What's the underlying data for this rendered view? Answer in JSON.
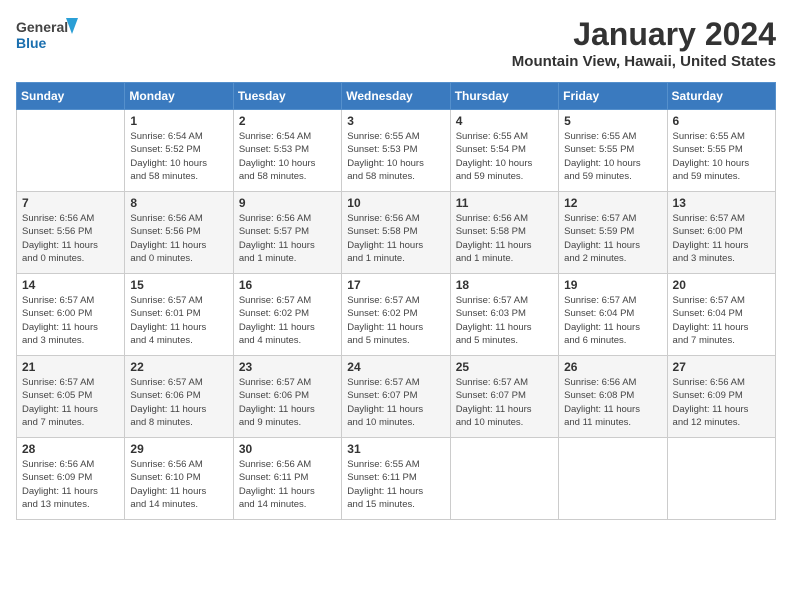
{
  "header": {
    "logo_line1": "General",
    "logo_line2": "Blue",
    "title": "January 2024",
    "subtitle": "Mountain View, Hawaii, United States"
  },
  "days_of_week": [
    "Sunday",
    "Monday",
    "Tuesday",
    "Wednesday",
    "Thursday",
    "Friday",
    "Saturday"
  ],
  "weeks": [
    [
      {
        "day": "",
        "info": ""
      },
      {
        "day": "1",
        "info": "Sunrise: 6:54 AM\nSunset: 5:52 PM\nDaylight: 10 hours\nand 58 minutes."
      },
      {
        "day": "2",
        "info": "Sunrise: 6:54 AM\nSunset: 5:53 PM\nDaylight: 10 hours\nand 58 minutes."
      },
      {
        "day": "3",
        "info": "Sunrise: 6:55 AM\nSunset: 5:53 PM\nDaylight: 10 hours\nand 58 minutes."
      },
      {
        "day": "4",
        "info": "Sunrise: 6:55 AM\nSunset: 5:54 PM\nDaylight: 10 hours\nand 59 minutes."
      },
      {
        "day": "5",
        "info": "Sunrise: 6:55 AM\nSunset: 5:55 PM\nDaylight: 10 hours\nand 59 minutes."
      },
      {
        "day": "6",
        "info": "Sunrise: 6:55 AM\nSunset: 5:55 PM\nDaylight: 10 hours\nand 59 minutes."
      }
    ],
    [
      {
        "day": "7",
        "info": "Sunrise: 6:56 AM\nSunset: 5:56 PM\nDaylight: 11 hours\nand 0 minutes."
      },
      {
        "day": "8",
        "info": "Sunrise: 6:56 AM\nSunset: 5:56 PM\nDaylight: 11 hours\nand 0 minutes."
      },
      {
        "day": "9",
        "info": "Sunrise: 6:56 AM\nSunset: 5:57 PM\nDaylight: 11 hours\nand 1 minute."
      },
      {
        "day": "10",
        "info": "Sunrise: 6:56 AM\nSunset: 5:58 PM\nDaylight: 11 hours\nand 1 minute."
      },
      {
        "day": "11",
        "info": "Sunrise: 6:56 AM\nSunset: 5:58 PM\nDaylight: 11 hours\nand 1 minute."
      },
      {
        "day": "12",
        "info": "Sunrise: 6:57 AM\nSunset: 5:59 PM\nDaylight: 11 hours\nand 2 minutes."
      },
      {
        "day": "13",
        "info": "Sunrise: 6:57 AM\nSunset: 6:00 PM\nDaylight: 11 hours\nand 3 minutes."
      }
    ],
    [
      {
        "day": "14",
        "info": "Sunrise: 6:57 AM\nSunset: 6:00 PM\nDaylight: 11 hours\nand 3 minutes."
      },
      {
        "day": "15",
        "info": "Sunrise: 6:57 AM\nSunset: 6:01 PM\nDaylight: 11 hours\nand 4 minutes."
      },
      {
        "day": "16",
        "info": "Sunrise: 6:57 AM\nSunset: 6:02 PM\nDaylight: 11 hours\nand 4 minutes."
      },
      {
        "day": "17",
        "info": "Sunrise: 6:57 AM\nSunset: 6:02 PM\nDaylight: 11 hours\nand 5 minutes."
      },
      {
        "day": "18",
        "info": "Sunrise: 6:57 AM\nSunset: 6:03 PM\nDaylight: 11 hours\nand 5 minutes."
      },
      {
        "day": "19",
        "info": "Sunrise: 6:57 AM\nSunset: 6:04 PM\nDaylight: 11 hours\nand 6 minutes."
      },
      {
        "day": "20",
        "info": "Sunrise: 6:57 AM\nSunset: 6:04 PM\nDaylight: 11 hours\nand 7 minutes."
      }
    ],
    [
      {
        "day": "21",
        "info": "Sunrise: 6:57 AM\nSunset: 6:05 PM\nDaylight: 11 hours\nand 7 minutes."
      },
      {
        "day": "22",
        "info": "Sunrise: 6:57 AM\nSunset: 6:06 PM\nDaylight: 11 hours\nand 8 minutes."
      },
      {
        "day": "23",
        "info": "Sunrise: 6:57 AM\nSunset: 6:06 PM\nDaylight: 11 hours\nand 9 minutes."
      },
      {
        "day": "24",
        "info": "Sunrise: 6:57 AM\nSunset: 6:07 PM\nDaylight: 11 hours\nand 10 minutes."
      },
      {
        "day": "25",
        "info": "Sunrise: 6:57 AM\nSunset: 6:07 PM\nDaylight: 11 hours\nand 10 minutes."
      },
      {
        "day": "26",
        "info": "Sunrise: 6:56 AM\nSunset: 6:08 PM\nDaylight: 11 hours\nand 11 minutes."
      },
      {
        "day": "27",
        "info": "Sunrise: 6:56 AM\nSunset: 6:09 PM\nDaylight: 11 hours\nand 12 minutes."
      }
    ],
    [
      {
        "day": "28",
        "info": "Sunrise: 6:56 AM\nSunset: 6:09 PM\nDaylight: 11 hours\nand 13 minutes."
      },
      {
        "day": "29",
        "info": "Sunrise: 6:56 AM\nSunset: 6:10 PM\nDaylight: 11 hours\nand 14 minutes."
      },
      {
        "day": "30",
        "info": "Sunrise: 6:56 AM\nSunset: 6:11 PM\nDaylight: 11 hours\nand 14 minutes."
      },
      {
        "day": "31",
        "info": "Sunrise: 6:55 AM\nSunset: 6:11 PM\nDaylight: 11 hours\nand 15 minutes."
      },
      {
        "day": "",
        "info": ""
      },
      {
        "day": "",
        "info": ""
      },
      {
        "day": "",
        "info": ""
      }
    ]
  ]
}
